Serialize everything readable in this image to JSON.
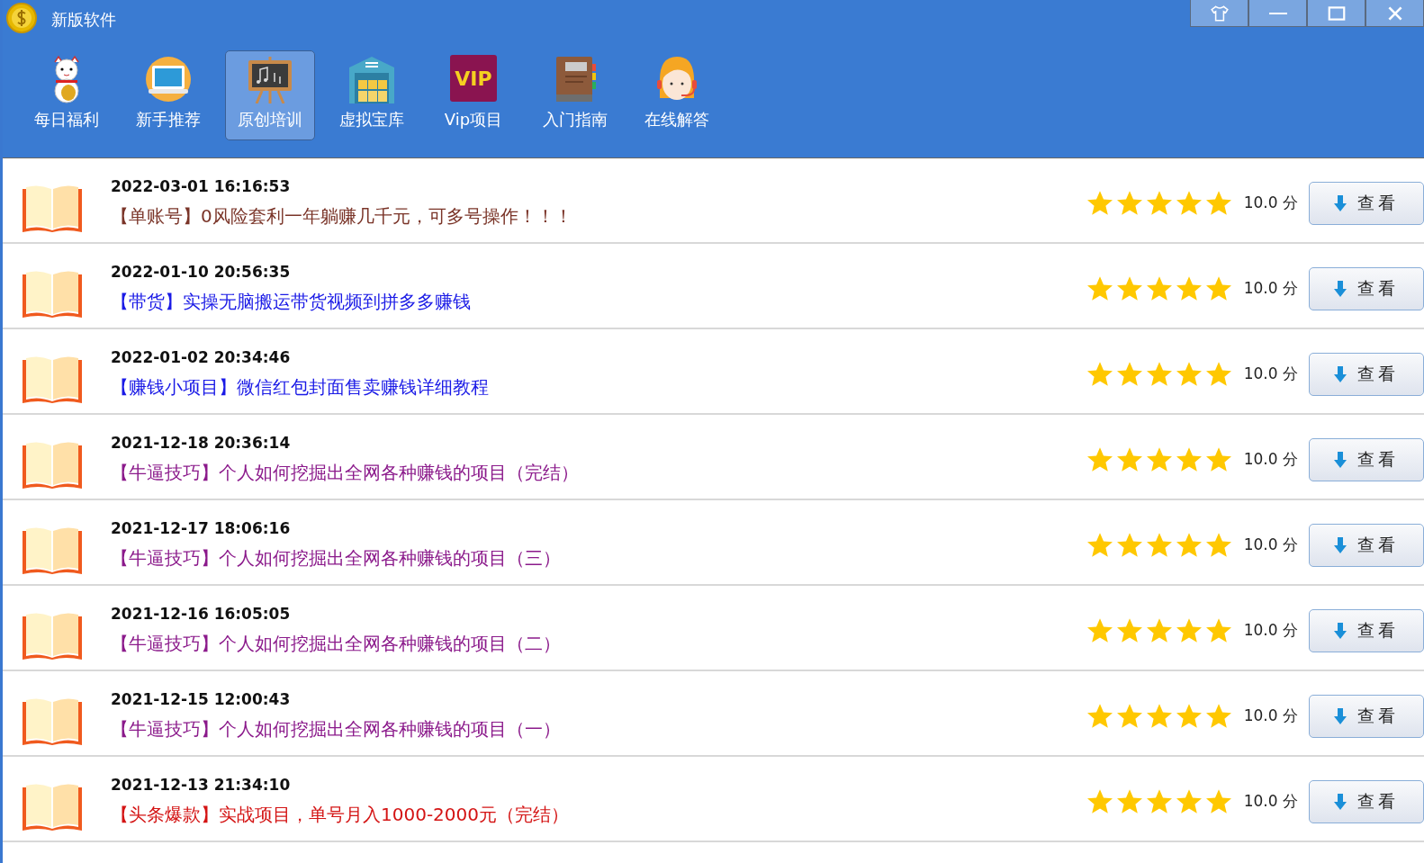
{
  "window": {
    "title": "新版软件"
  },
  "toolbar": [
    {
      "label": "每日福利",
      "kind": "cat",
      "selected": false
    },
    {
      "label": "新手推荐",
      "kind": "laptop",
      "selected": false
    },
    {
      "label": "原创培训",
      "kind": "board",
      "selected": true
    },
    {
      "label": "虚拟宝库",
      "kind": "warehouse",
      "selected": false
    },
    {
      "label": "Vip项目",
      "kind": "vip",
      "selected": false
    },
    {
      "label": "入门指南",
      "kind": "book",
      "selected": false
    },
    {
      "label": "在线解答",
      "kind": "support",
      "selected": false
    }
  ],
  "vip_icon_text": "VIP",
  "items": [
    {
      "date": "2022-03-01 16:16:53",
      "title": "【单账号】0风险套利一年躺赚几千元，可多号操作！！！",
      "color": "#7a3428",
      "stars": 5,
      "score": "10.0 分",
      "button": "查看"
    },
    {
      "date": "2022-01-10 20:56:35",
      "title": "【带货】实操无脑搬运带货视频到拼多多赚钱",
      "color": "#1a1ae6",
      "stars": 5,
      "score": "10.0 分",
      "button": "查看"
    },
    {
      "date": "2022-01-02 20:34:46",
      "title": "【赚钱小项目】微信红包封面售卖赚钱详细教程",
      "color": "#1a1ae6",
      "stars": 5,
      "score": "10.0 分",
      "button": "查看"
    },
    {
      "date": "2021-12-18 20:36:14",
      "title": "【牛逼技巧】个人如何挖掘出全网各种赚钱的项目（完结）",
      "color": "#8b1a8b",
      "stars": 5,
      "score": "10.0 分",
      "button": "查看"
    },
    {
      "date": "2021-12-17 18:06:16",
      "title": "【牛逼技巧】个人如何挖掘出全网各种赚钱的项目（三）",
      "color": "#8b1a8b",
      "stars": 5,
      "score": "10.0 分",
      "button": "查看"
    },
    {
      "date": "2021-12-16 16:05:05",
      "title": "【牛逼技巧】个人如何挖掘出全网各种赚钱的项目（二）",
      "color": "#8b1a8b",
      "stars": 5,
      "score": "10.0 分",
      "button": "查看"
    },
    {
      "date": "2021-12-15 12:00:43",
      "title": "【牛逼技巧】个人如何挖掘出全网各种赚钱的项目（一）",
      "color": "#8b1a8b",
      "stars": 5,
      "score": "10.0 分",
      "button": "查看"
    },
    {
      "date": "2021-12-13 21:34:10",
      "title": "【头条爆款】实战项目，单号月入1000-2000元（完结）",
      "color": "#d41414",
      "stars": 5,
      "score": "10.0 分",
      "button": "查看"
    }
  ]
}
